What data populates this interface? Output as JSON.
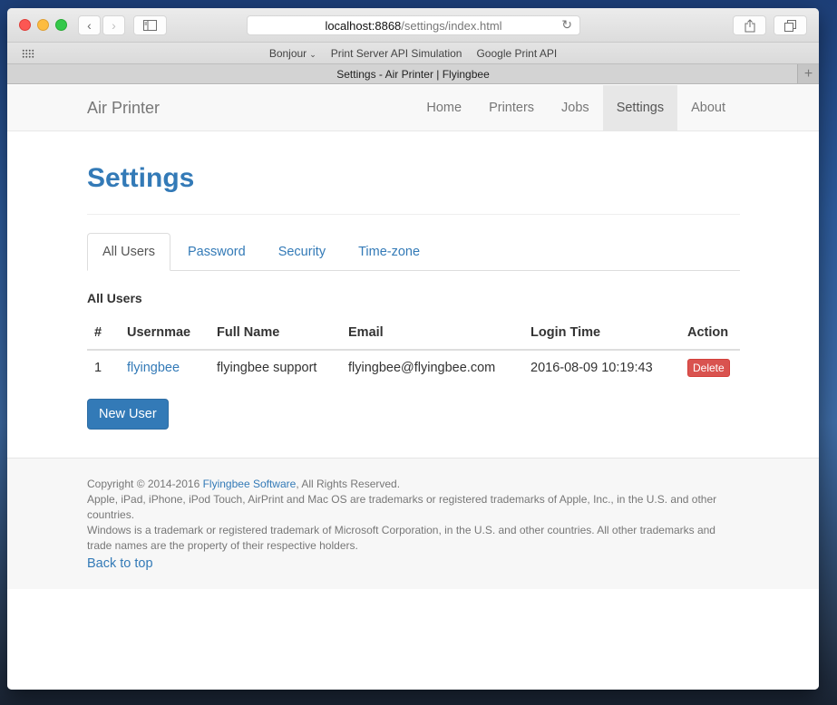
{
  "browser": {
    "url_host": "localhost:8868",
    "url_path": "/settings/index.html",
    "favorites": [
      {
        "label": "Bonjour",
        "has_dropdown": true
      },
      {
        "label": "Print Server API Simulation"
      },
      {
        "label": "Google Print API"
      }
    ],
    "tab_title": "Settings - Air Printer | Flyingbee",
    "icons": {
      "back": "‹",
      "forward": "›",
      "reload": "↻",
      "new_tab": "+"
    }
  },
  "navbar": {
    "brand": "Air Printer",
    "items": [
      {
        "label": "Home"
      },
      {
        "label": "Printers"
      },
      {
        "label": "Jobs"
      },
      {
        "label": "Settings",
        "active": true
      },
      {
        "label": "About"
      }
    ]
  },
  "page": {
    "title": "Settings",
    "tabs": [
      {
        "label": "All Users",
        "active": true
      },
      {
        "label": "Password"
      },
      {
        "label": "Security"
      },
      {
        "label": "Time-zone"
      }
    ],
    "section_title": "All Users",
    "table": {
      "headers": [
        "#",
        "Usernmae",
        "Full Name",
        "Email",
        "Login Time",
        "Action"
      ],
      "rows": [
        {
          "index": "1",
          "username": "flyingbee",
          "full_name": "flyingbee support",
          "email": "flyingbee@flyingbee.com",
          "login_time": "2016-08-09 10:19:43",
          "action": "Delete"
        }
      ]
    },
    "new_user_label": "New User"
  },
  "footer": {
    "copyright_prefix": "Copyright © 2014-2016 ",
    "company_link": "Flyingbee Software",
    "copyright_suffix": ", All Rights Reserved.",
    "apple_notice": "Apple, iPad, iPhone, iPod Touch, AirPrint and Mac OS are trademarks or registered trademarks of Apple, Inc., in the U.S. and other countries.",
    "windows_notice": "Windows is a trademark or registered trademark of Microsoft Corporation, in the U.S. and other countries. All other trademarks and trade names are the property of their respective holders.",
    "back_to_top": "Back to top"
  },
  "colors": {
    "primary": "#337ab7",
    "danger": "#d9534f",
    "navbar_bg": "#f8f8f8",
    "footer_bg": "#f7f7f7"
  }
}
